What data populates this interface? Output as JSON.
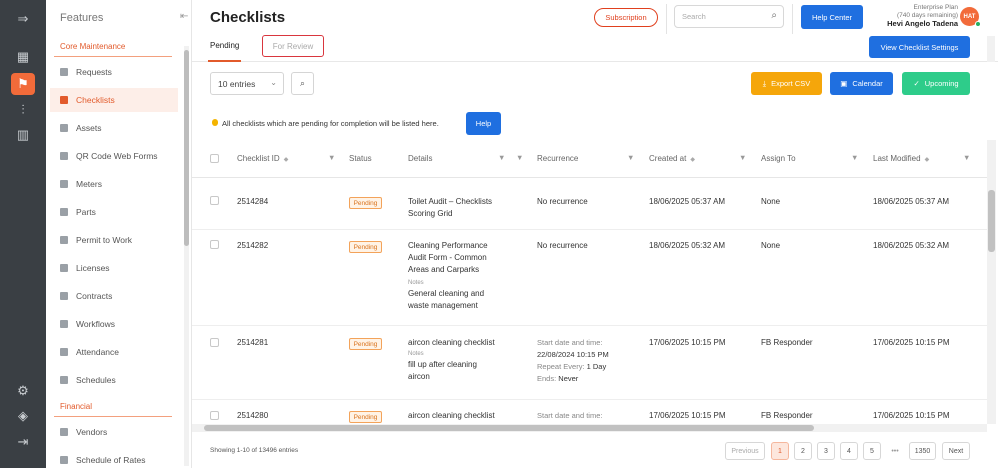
{
  "rail": {
    "icons": [
      "collapse-menu-icon",
      "dashboard-icon",
      "maintenance-icon",
      "analytics-icon",
      "reports-icon",
      "settings-icon",
      "package-icon",
      "logout-icon"
    ]
  },
  "sidebar": {
    "title": "Features",
    "sections": [
      {
        "label": "Core Maintenance"
      },
      {
        "label": "Financial"
      }
    ],
    "items": [
      {
        "label": "Requests"
      },
      {
        "label": "Checklists"
      },
      {
        "label": "Assets"
      },
      {
        "label": "QR Code Web Forms"
      },
      {
        "label": "Meters"
      },
      {
        "label": "Parts"
      },
      {
        "label": "Permit to Work"
      },
      {
        "label": "Licenses"
      },
      {
        "label": "Contracts"
      },
      {
        "label": "Workflows"
      },
      {
        "label": "Attendance"
      },
      {
        "label": "Schedules"
      },
      {
        "label": "Vendors"
      },
      {
        "label": "Schedule of Rates"
      }
    ],
    "active_item": "Checklists"
  },
  "header": {
    "title": "Checklists",
    "subscription_label": "Subscription",
    "search_placeholder": "Search",
    "help_center_label": "Help Center",
    "plan_name": "Enterprise Plan",
    "plan_days": "(740 days remaining)",
    "user_name": "Hevi Angelo Tadena",
    "avatar_initials": "HAT"
  },
  "tabs": {
    "pending": "Pending",
    "for_review": "For Review",
    "view_settings_label": "View Checklist Settings"
  },
  "toolbar": {
    "entries_value": "10 entries",
    "export_csv_label": "Export CSV",
    "calendar_label": "Calendar",
    "upcoming_label": "Upcoming"
  },
  "info": {
    "text": "All checklists which are pending for completion will be listed here.",
    "help_label": "Help"
  },
  "table": {
    "columns": {
      "checklist_id": "Checklist ID",
      "status": "Status",
      "details": "Details",
      "recurrence": "Recurrence",
      "created_at": "Created at",
      "assign_to": "Assign To",
      "last_modified": "Last Modified"
    },
    "notes_label": "Notes",
    "rows": [
      {
        "id": "2514284",
        "status": "Pending",
        "details": "Toilet Audit – Checklists Scoring Grid",
        "notes": "",
        "recurrence": "No recurrence",
        "created_at": "18/06/2025 05:37 AM",
        "assign_to": "None",
        "last_modified": "18/06/2025 05:37 AM"
      },
      {
        "id": "2514282",
        "status": "Pending",
        "details": "Cleaning Performance Audit Form - Common Areas and Carparks",
        "notes": "General cleaning and waste management",
        "recurrence": "No recurrence",
        "created_at": "18/06/2025 05:32 AM",
        "assign_to": "None",
        "last_modified": "18/06/2025 05:32 AM"
      },
      {
        "id": "2514281",
        "status": "Pending",
        "details": "aircon cleaning checklist",
        "notes": "fill up after cleaning aircon",
        "recurrence_label": "Start date and time:",
        "recurrence_start": "22/08/2024 10:15 PM",
        "recurrence_repeat_label": "Repeat Every:",
        "recurrence_repeat": "1 Day",
        "recurrence_ends_label": "Ends:",
        "recurrence_ends": "Never",
        "created_at": "17/06/2025 10:15 PM",
        "assign_to": "FB Responder",
        "last_modified": "17/06/2025 10:15 PM"
      },
      {
        "id": "2514280",
        "status": "Pending",
        "details": "aircon cleaning checklist",
        "recurrence_label": "Start date and time:",
        "created_at": "17/06/2025 10:15 PM",
        "assign_to": "FB Responder",
        "last_modified": "17/06/2025 10:15 PM"
      }
    ]
  },
  "footer": {
    "showing": "Showing 1-10 of 13496 entries",
    "previous": "Previous",
    "pages": [
      "1",
      "2",
      "3",
      "4",
      "5"
    ],
    "ellipsis": "•••",
    "last_page": "1350",
    "next": "Next"
  },
  "colors": {
    "accent": "#e25a2b",
    "primary": "#1f6fe0",
    "export": "#f5a60a",
    "upcoming": "#2ecc8a",
    "rail": "#3a3f44"
  }
}
